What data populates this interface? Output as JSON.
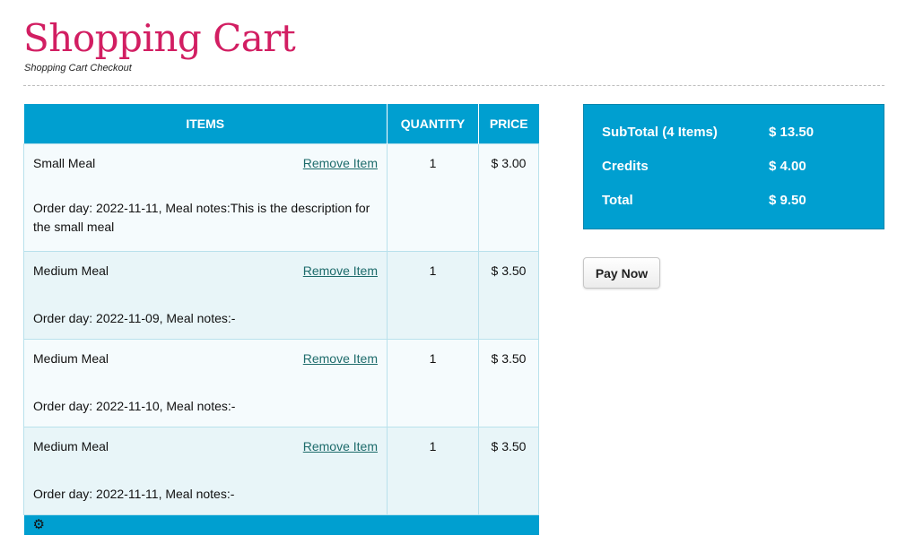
{
  "header": {
    "title": "Shopping Cart",
    "subtitle": "Shopping Cart Checkout"
  },
  "cart": {
    "columns": [
      "ITEMS",
      "QUANTITY",
      "PRICE"
    ],
    "remove_label": "Remove Item",
    "items": [
      {
        "name": "Small Meal",
        "notes": "Order day: 2022-11-11, Meal notes:This is the description for the small meal",
        "quantity": "1",
        "price": "$ 3.00"
      },
      {
        "name": "Medium Meal",
        "notes": "Order day: 2022-11-09, Meal notes:-",
        "quantity": "1",
        "price": "$ 3.50"
      },
      {
        "name": "Medium Meal",
        "notes": "Order day: 2022-11-10, Meal notes:-",
        "quantity": "1",
        "price": "$ 3.50"
      },
      {
        "name": "Medium Meal",
        "notes": "Order day: 2022-11-11, Meal notes:-",
        "quantity": "1",
        "price": "$ 3.50"
      }
    ],
    "footer_icon": "gear-icon"
  },
  "summary": {
    "subtotal_label": "SubTotal (4 Items)",
    "subtotal_value": "$ 13.50",
    "credits_label": "Credits",
    "credits_value": "$ 4.00",
    "total_label": "Total",
    "total_value": "$ 9.50"
  },
  "actions": {
    "pay_label": "Pay Now"
  },
  "colors": {
    "title": "#d21e62",
    "accent": "#009fd0",
    "row_light": "#f5fbfd",
    "row_tint": "#e8f5f8",
    "link": "#1d6b6b"
  }
}
